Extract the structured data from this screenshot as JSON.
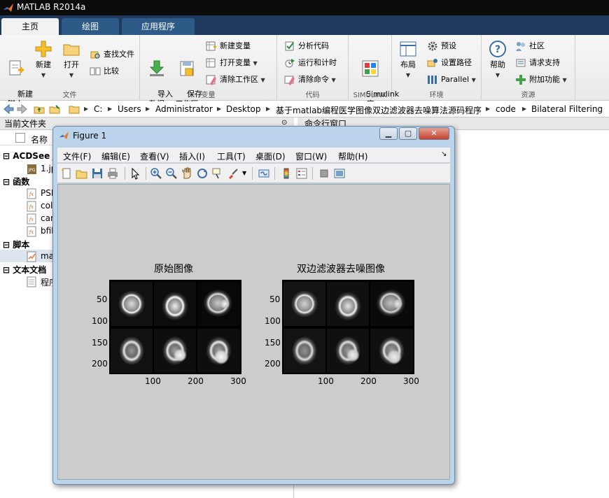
{
  "app": {
    "window_title": "MATLAB R2014a"
  },
  "ribbon": {
    "tabs": [
      {
        "label": "主页"
      },
      {
        "label": "绘图"
      },
      {
        "label": "应用程序"
      }
    ],
    "groups": {
      "file": {
        "label": "文件",
        "new_script": "新建\n脚本",
        "new": "新建",
        "open": "打开",
        "find_files": "查找文件",
        "compare": "比较"
      },
      "variable": {
        "label": "变量",
        "import_data": "导入\n数据",
        "save_workspace": "保存\n工作区",
        "new_variable": "新建变量",
        "open_variable": "打开变量",
        "clear_workspace": "清除工作区"
      },
      "code": {
        "label": "代码",
        "analyze_code": "分析代码",
        "run_and_time": "运行和计时",
        "clear_commands": "清除命令"
      },
      "simulink": {
        "label": "SIMULINK",
        "library": "Simulink\n库"
      },
      "environment": {
        "label": "环境",
        "layout": "布局",
        "preferences": "预设",
        "set_path": "设置路径",
        "parallel": "Parallel"
      },
      "resources": {
        "label": "资源",
        "help": "帮助",
        "community": "社区",
        "request_support": "请求支持",
        "add_ons": "附加功能"
      }
    }
  },
  "address_bar": {
    "crumbs": [
      "C:",
      "Users",
      "Administrator",
      "Desktop",
      "基于matlab编程医学图像双边滤波器去噪算法源码程序",
      "code",
      "Bilateral Filtering"
    ]
  },
  "file_panel": {
    "title": "当前文件夹",
    "column_name": "名称",
    "sections": [
      {
        "label": "ACDSee J"
      },
      {
        "label": "函数"
      },
      {
        "label": "脚本"
      },
      {
        "label": "文本文档"
      }
    ],
    "items": [
      {
        "label": "1.jp"
      },
      {
        "label": "PSN"
      },
      {
        "label": "col"
      },
      {
        "label": "car"
      },
      {
        "label": "bfil"
      },
      {
        "label": "mai"
      },
      {
        "label": "程序"
      }
    ]
  },
  "command_window": {
    "title": "命令行窗口"
  },
  "figure": {
    "title": "Figure 1",
    "menu": [
      "文件(F)",
      "编辑(E)",
      "查看(V)",
      "插入(I)",
      "工具(T)",
      "桌面(D)",
      "窗口(W)",
      "帮助(H)"
    ],
    "axes": [
      {
        "title": "原始图像",
        "yticks": [
          "50",
          "100",
          "150",
          "200"
        ],
        "xticks": [
          "100",
          "200",
          "300"
        ]
      },
      {
        "title": "双边滤波器去噪图像",
        "yticks": [
          "50",
          "100",
          "150",
          "200"
        ],
        "xticks": [
          "100",
          "200",
          "300"
        ]
      }
    ]
  }
}
